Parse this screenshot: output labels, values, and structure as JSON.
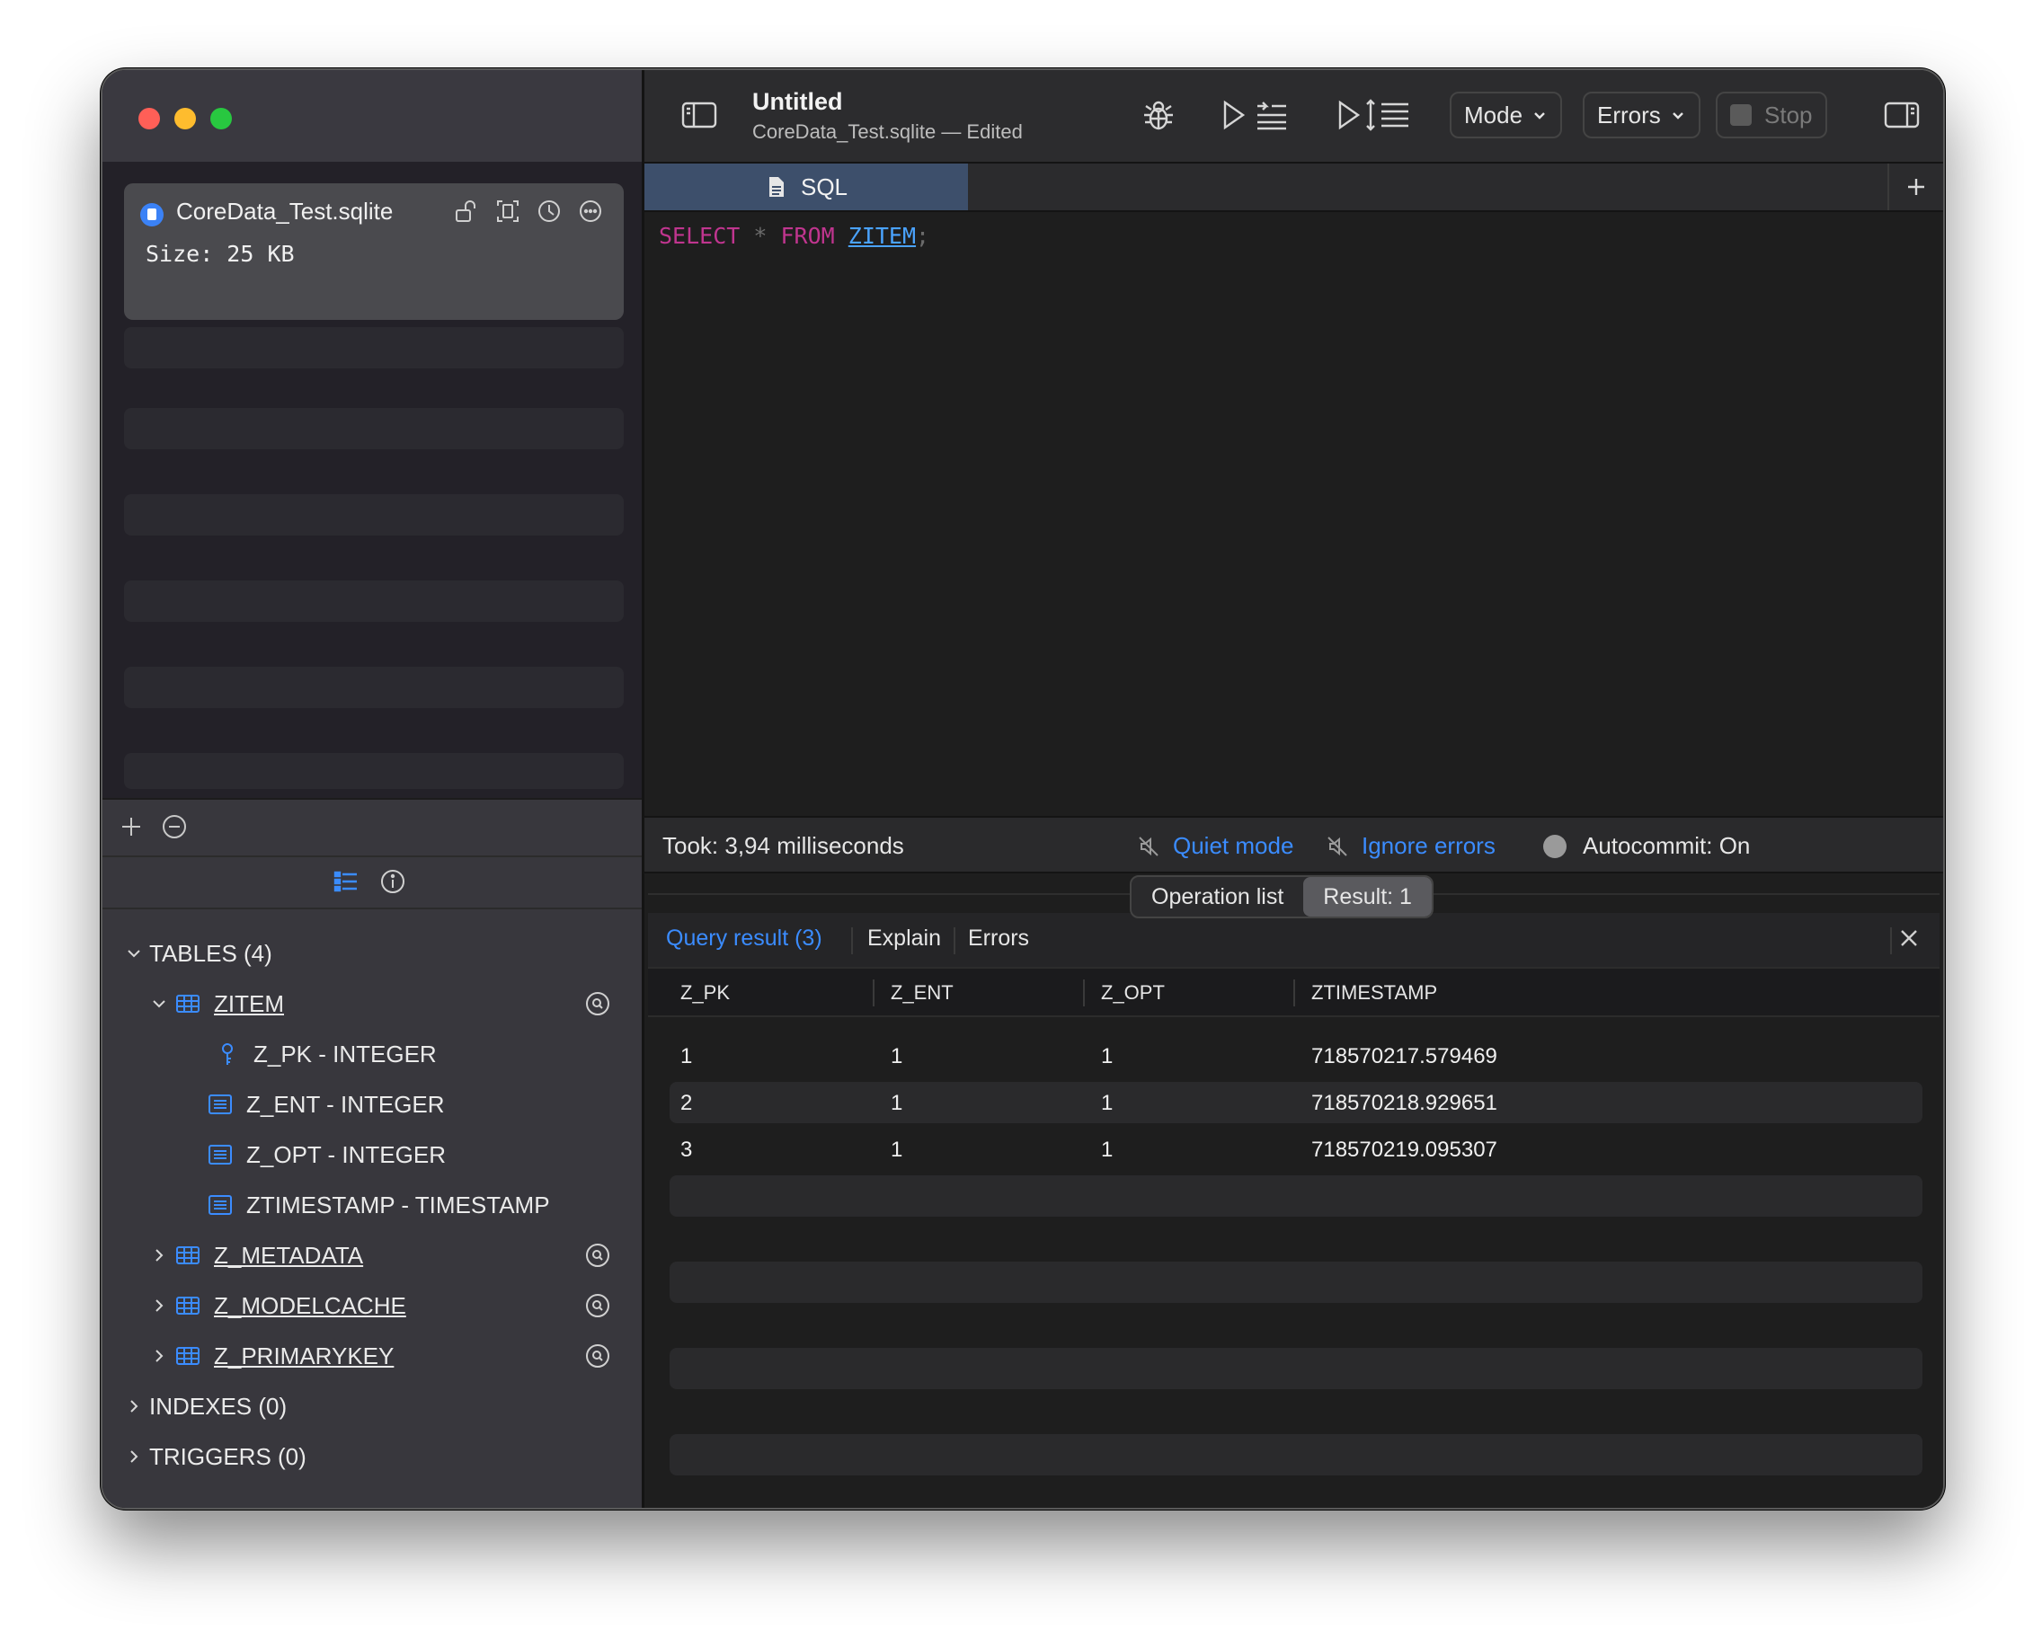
{
  "window": {
    "title": "Untitled",
    "subtitle": "CoreData_Test.sqlite — Edited"
  },
  "database": {
    "name": "CoreData_Test.sqlite",
    "size": "Size: 25 KB"
  },
  "toolbar": {
    "mode_label": "Mode",
    "errors_label": "Errors",
    "stop_label": "Stop"
  },
  "editor": {
    "tab_label": "SQL",
    "query": {
      "select": "SELECT",
      "star": "*",
      "from": "FROM",
      "table": "ZITEM",
      "semicolon": ";"
    }
  },
  "status": {
    "took": "Took: 3,94 milliseconds",
    "quiet_mode": "Quiet mode",
    "ignore_errors": "Ignore errors",
    "autocommit": "Autocommit: On"
  },
  "segments": {
    "operation_list": "Operation list",
    "result": "Result: 1"
  },
  "result_tabs": {
    "query_result": "Query result (3)",
    "explain": "Explain",
    "errors": "Errors"
  },
  "grid": {
    "columns": [
      "Z_PK",
      "Z_ENT",
      "Z_OPT",
      "ZTIMESTAMP"
    ],
    "rows": [
      [
        "1",
        "1",
        "1",
        "718570217.579469"
      ],
      [
        "2",
        "1",
        "1",
        "718570218.929651"
      ],
      [
        "3",
        "1",
        "1",
        "718570219.095307"
      ]
    ]
  },
  "tree": {
    "tables_header": "TABLES (4)",
    "zitem": "ZITEM",
    "columns": [
      "Z_PK - INTEGER",
      "Z_ENT - INTEGER",
      "Z_OPT - INTEGER",
      "ZTIMESTAMP - TIMESTAMP"
    ],
    "other_tables": [
      "Z_METADATA",
      "Z_MODELCACHE",
      "Z_PRIMARYKEY"
    ],
    "indexes_header": "INDEXES (0)",
    "triggers_header": "TRIGGERS (0)"
  },
  "colors": {
    "accent": "#3b8cff",
    "keyword": "#c0358f",
    "sql_tab": "#3d4f6b"
  }
}
